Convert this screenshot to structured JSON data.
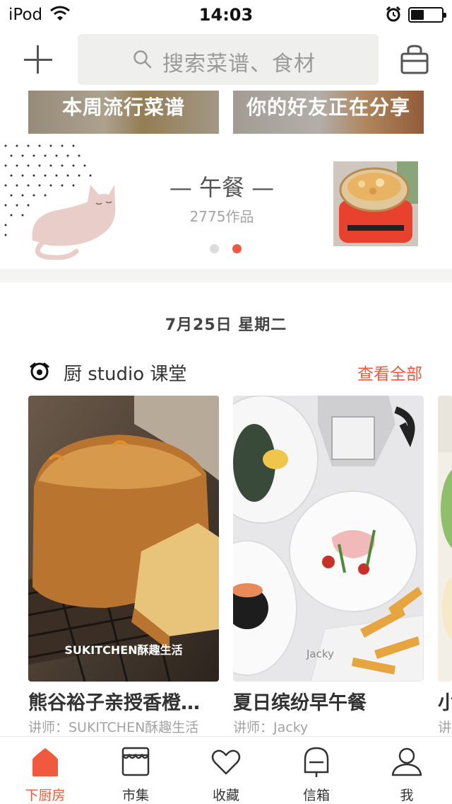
{
  "status_bar": {
    "carrier": "iPod",
    "time": "14:03"
  },
  "header": {
    "search_placeholder": "搜索菜谱、食材"
  },
  "banners": [
    {
      "label": "本周流行菜谱"
    },
    {
      "label": "你的好友正在分享"
    }
  ],
  "meal": {
    "title": "— 午餐 —",
    "count": "2775作品",
    "page_count": 2,
    "active_page": 2
  },
  "date": "7月25日 星期二",
  "section": {
    "title": "厨 studio 课堂",
    "see_all": "查看全部"
  },
  "courses": [
    {
      "name": "熊谷裕子亲授香橙…",
      "teacher": "讲师：SUKITCHEN酥趣生活",
      "watermark": "SUKITCHEN酥趣生活"
    },
    {
      "name": "夏日缤纷早午餐",
      "teacher": "讲师：Jacky",
      "watermark": "Jacky"
    },
    {
      "name": "小",
      "teacher": "讲"
    }
  ],
  "tabs": [
    {
      "label": "下厨房",
      "icon": "home-icon",
      "active": true
    },
    {
      "label": "市集",
      "icon": "market-icon",
      "active": false
    },
    {
      "label": "收藏",
      "icon": "heart-icon",
      "active": false
    },
    {
      "label": "信箱",
      "icon": "mailbox-icon",
      "active": false
    },
    {
      "label": "我",
      "icon": "profile-icon",
      "active": false
    }
  ],
  "colors": {
    "accent": "#f0593d",
    "text": "#333333",
    "muted": "#a3a3a3",
    "search_bg": "#efefed"
  }
}
